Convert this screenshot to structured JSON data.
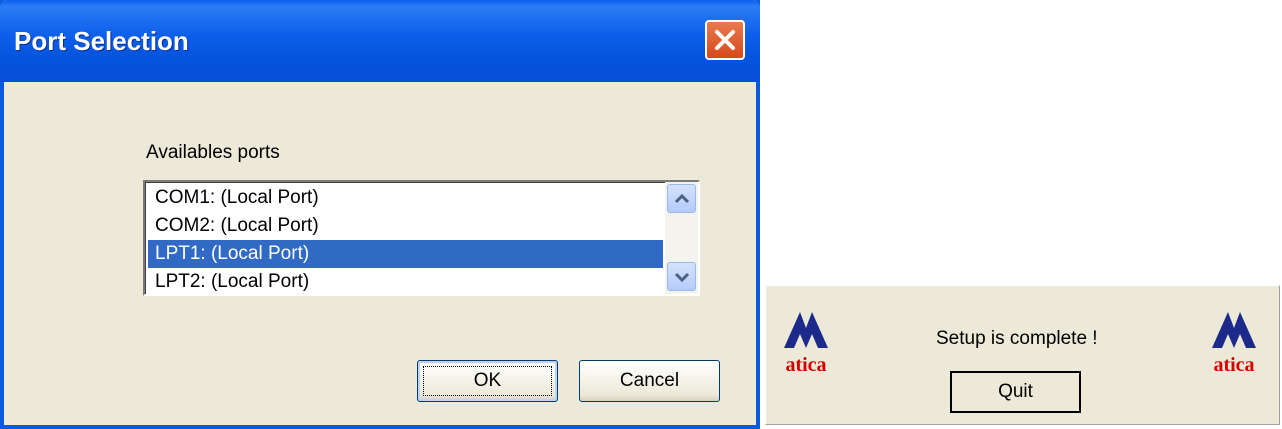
{
  "dialog": {
    "title": "Port Selection",
    "close_icon": "close-icon",
    "ports_label": "Availables ports",
    "ports": [
      {
        "label": "COM1:  (Local Port)",
        "selected": false
      },
      {
        "label": "COM2:  (Local Port)",
        "selected": false
      },
      {
        "label": "LPT1:  (Local Port)",
        "selected": true
      },
      {
        "label": "LPT2:  (Local Port)",
        "selected": false
      }
    ],
    "ok_label": "OK",
    "cancel_label": "Cancel"
  },
  "setup": {
    "logo_text": "atica",
    "message": "Setup is complete !",
    "quit_label": "Quit"
  },
  "colors": {
    "title_bar": "#0a5ae0",
    "selection": "#316ac5",
    "dialog_bg": "#ece9d8",
    "logo_blue": "#1c2a8c",
    "logo_red": "#d40000"
  }
}
